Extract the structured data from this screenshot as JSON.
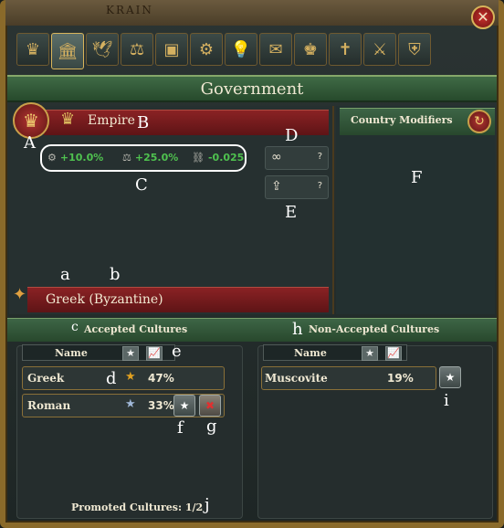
{
  "map_label": "KRAIN",
  "close_symbol": "✕",
  "tabs": [
    {
      "icon": "crown-icon",
      "glyph": "♛",
      "active": false
    },
    {
      "icon": "government-building-icon",
      "glyph": "🏛",
      "active": true
    },
    {
      "icon": "dove-icon",
      "glyph": "🕊",
      "active": false
    },
    {
      "icon": "trade-goods-icon",
      "glyph": "⚖",
      "active": false
    },
    {
      "icon": "crate-icon",
      "glyph": "▣",
      "active": false
    },
    {
      "icon": "gear-icon",
      "glyph": "⚙",
      "active": false
    },
    {
      "icon": "lightbulb-icon",
      "glyph": "💡",
      "active": false
    },
    {
      "icon": "scroll-icon",
      "glyph": "✉",
      "active": false
    },
    {
      "icon": "crown-flag-icon",
      "glyph": "♚",
      "active": false
    },
    {
      "icon": "cross-icon",
      "glyph": "✝",
      "active": false
    },
    {
      "icon": "military-icon",
      "glyph": "⚔",
      "active": false
    },
    {
      "icon": "shield-icon",
      "glyph": "⛨",
      "active": false
    }
  ],
  "title": "Government",
  "government": {
    "rank_icon": "crown-icon",
    "rank_glyph": "♛",
    "name": "Empire",
    "stats": [
      {
        "icon": "admin-icon",
        "glyph": "⚙",
        "value": "+10.0%"
      },
      {
        "icon": "coins-icon",
        "glyph": "⚖",
        "value": "+25.0%"
      },
      {
        "icon": "chain-icon",
        "glyph": "⛓",
        "value": "-0.025"
      }
    ],
    "mechanics": [
      {
        "icon": "link-icon",
        "glyph": "∞",
        "q": "?"
      },
      {
        "icon": "stairs-icon",
        "glyph": "⇪",
        "q": "?"
      }
    ]
  },
  "country_modifiers": {
    "label": "Country Modifiers",
    "button_glyph": "↻"
  },
  "culture": {
    "icon": "culture-icon",
    "glyph": "✦",
    "name": "Greek (Byzantine)"
  },
  "accepted": {
    "label": "Accepted Cultures",
    "header": {
      "name": "Name",
      "star": "★",
      "chart": "📈"
    },
    "rows": [
      {
        "name": "Greek",
        "star": "★",
        "star_color": "#e0a020",
        "pct": "47%"
      },
      {
        "name": "Roman",
        "star": "★",
        "star_color": "#a0b8d8",
        "pct": "33%"
      }
    ]
  },
  "non_accepted": {
    "label": "Non-Accepted Cultures",
    "header": {
      "name": "Name",
      "star": "★",
      "chart": "📈"
    },
    "rows": [
      {
        "name": "Muscovite",
        "pct": "19%"
      }
    ]
  },
  "promoted": "Promoted Cultures: 1/2",
  "annotations": {
    "A": "A",
    "B": "B",
    "C1": "C",
    "D": "D",
    "E": "E",
    "F": "F",
    "a": "a",
    "b": "b",
    "c": "c",
    "d": "d",
    "e": "e",
    "f": "f",
    "g": "g",
    "h": "h",
    "i": "i",
    "j": "j"
  }
}
